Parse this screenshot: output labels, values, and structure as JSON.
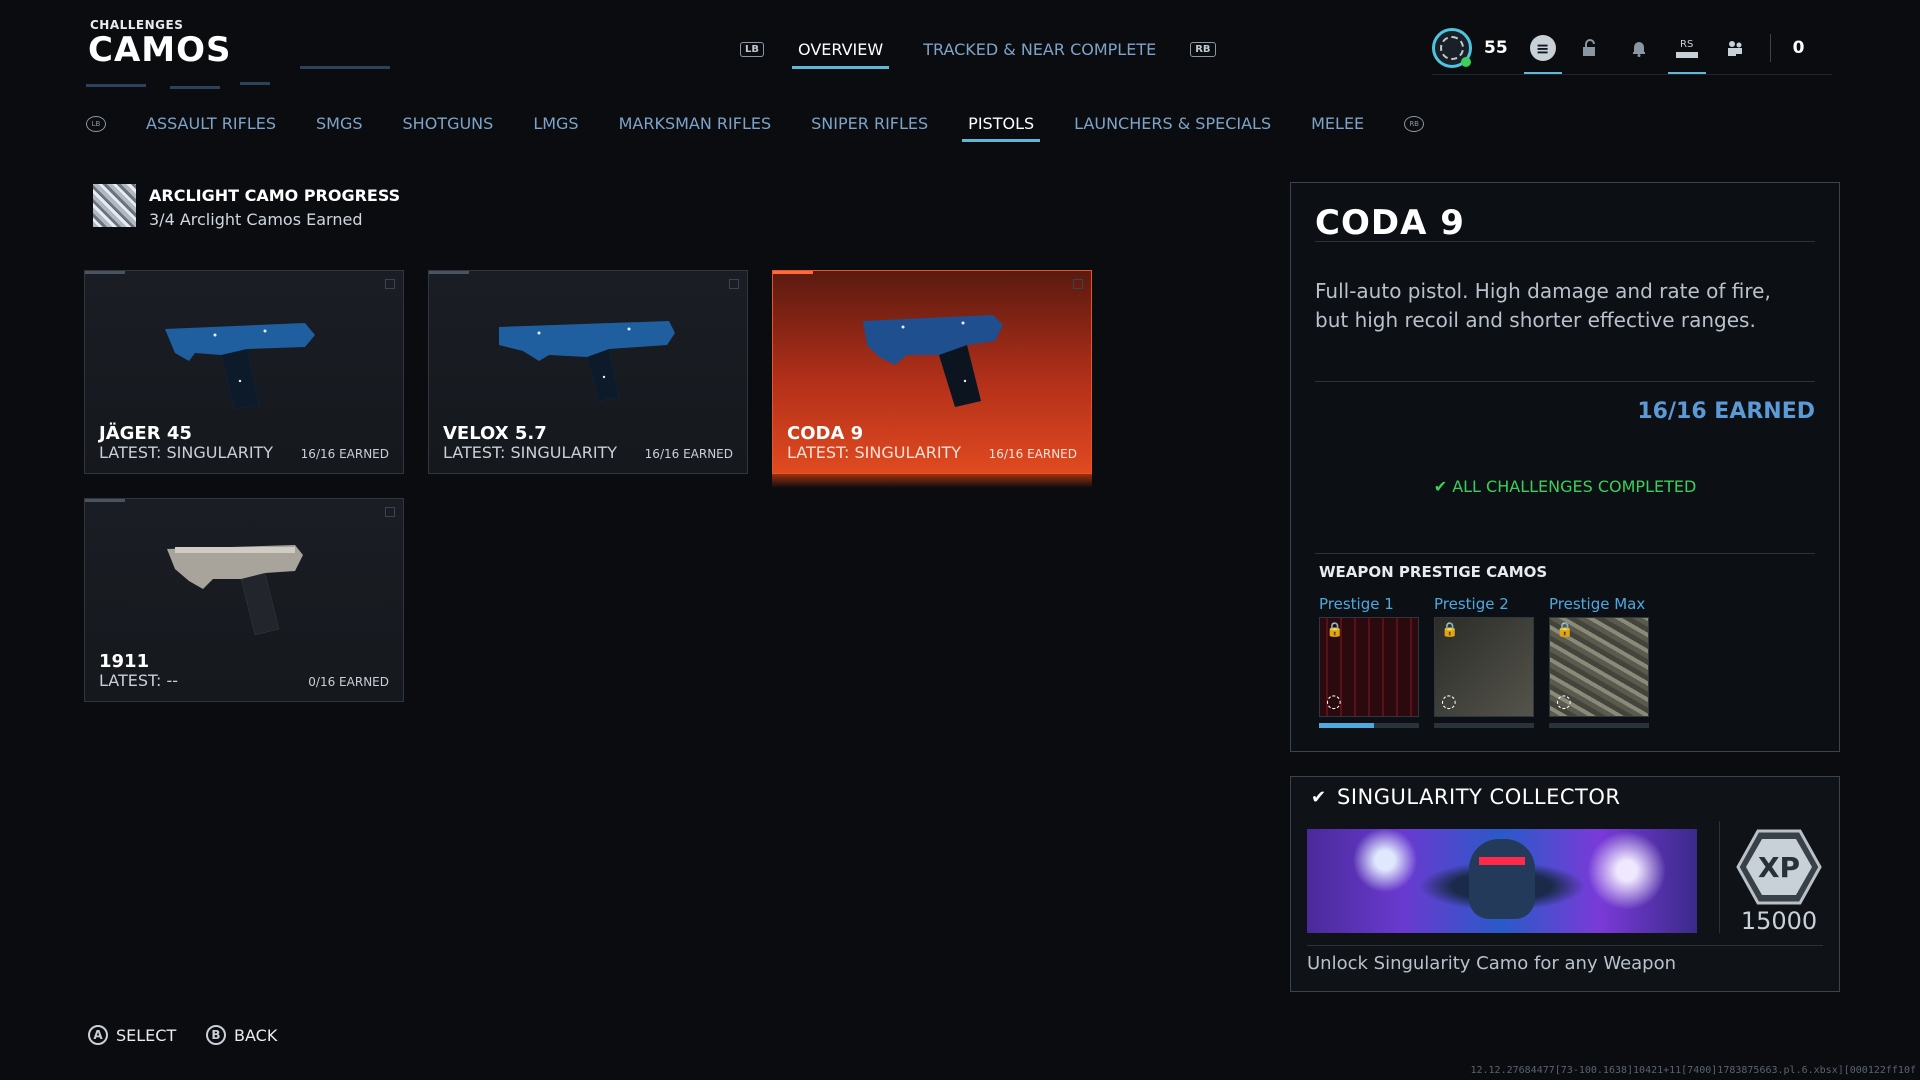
{
  "header": {
    "kicker": "CHALLENGES",
    "title": "CAMOS"
  },
  "top_tabs": {
    "lb_hint": "LB",
    "rb_hint": "RB",
    "items": [
      {
        "label": "OVERVIEW",
        "active": true
      },
      {
        "label": "TRACKED & NEAR COMPLETE",
        "active": false
      }
    ]
  },
  "status": {
    "level": "55",
    "rs_hint": "RS",
    "currency": "0",
    "online_color": "#3ad05a"
  },
  "categories": {
    "left_hint": "LB",
    "right_hint": "RB",
    "items": [
      {
        "label": "ASSAULT RIFLES",
        "active": false
      },
      {
        "label": "SMGS",
        "active": false
      },
      {
        "label": "SHOTGUNS",
        "active": false
      },
      {
        "label": "LMGS",
        "active": false
      },
      {
        "label": "MARKSMAN RIFLES",
        "active": false
      },
      {
        "label": "SNIPER RIFLES",
        "active": false
      },
      {
        "label": "PISTOLS",
        "active": true
      },
      {
        "label": "LAUNCHERS & SPECIALS",
        "active": false
      },
      {
        "label": "MELEE",
        "active": false
      }
    ]
  },
  "progress": {
    "title": "ARCLIGHT CAMO PROGRESS",
    "subtitle": "3/4 Arclight Camos Earned"
  },
  "weapons": [
    {
      "name": "JÄGER 45",
      "latest": "LATEST: SINGULARITY",
      "earned": "16/16 EARNED",
      "selected": false,
      "camo": "singularity"
    },
    {
      "name": "VELOX 5.7",
      "latest": "LATEST: SINGULARITY",
      "earned": "16/16 EARNED",
      "selected": false,
      "camo": "singularity"
    },
    {
      "name": "CODA 9",
      "latest": "LATEST: SINGULARITY",
      "earned": "16/16 EARNED",
      "selected": true,
      "camo": "singularity"
    },
    {
      "name": "1911",
      "latest": "LATEST: --",
      "earned": "0/16 EARNED",
      "selected": false,
      "camo": "none"
    }
  ],
  "detail": {
    "name": "CODA 9",
    "description": "Full-auto pistol. High damage and rate of fire, but high recoil and shorter effective ranges.",
    "earned": "16/16 EARNED",
    "completed": "ALL CHALLENGES COMPLETED",
    "prestige_title": "WEAPON PRESTIGE CAMOS",
    "prestige": [
      {
        "label": "Prestige 1",
        "progress": 0.55,
        "icon": "lock-icon"
      },
      {
        "label": "Prestige 2",
        "progress": 0,
        "icon": "lock-icon"
      },
      {
        "label": "Prestige Max",
        "progress": 0,
        "icon": "lock-icon"
      }
    ]
  },
  "reward": {
    "title": "SINGULARITY COLLECTOR",
    "xp": "15000",
    "xp_badge": "XP",
    "description": "Unlock Singularity Camo for any Weapon"
  },
  "footer": {
    "select_key": "A",
    "select_label": "SELECT",
    "back_key": "B",
    "back_label": "BACK"
  },
  "debug_text": "12.12.27684477[73-100.1638]10421+11[7400]1783875663.pl.6.xbsx][000122ff10f"
}
